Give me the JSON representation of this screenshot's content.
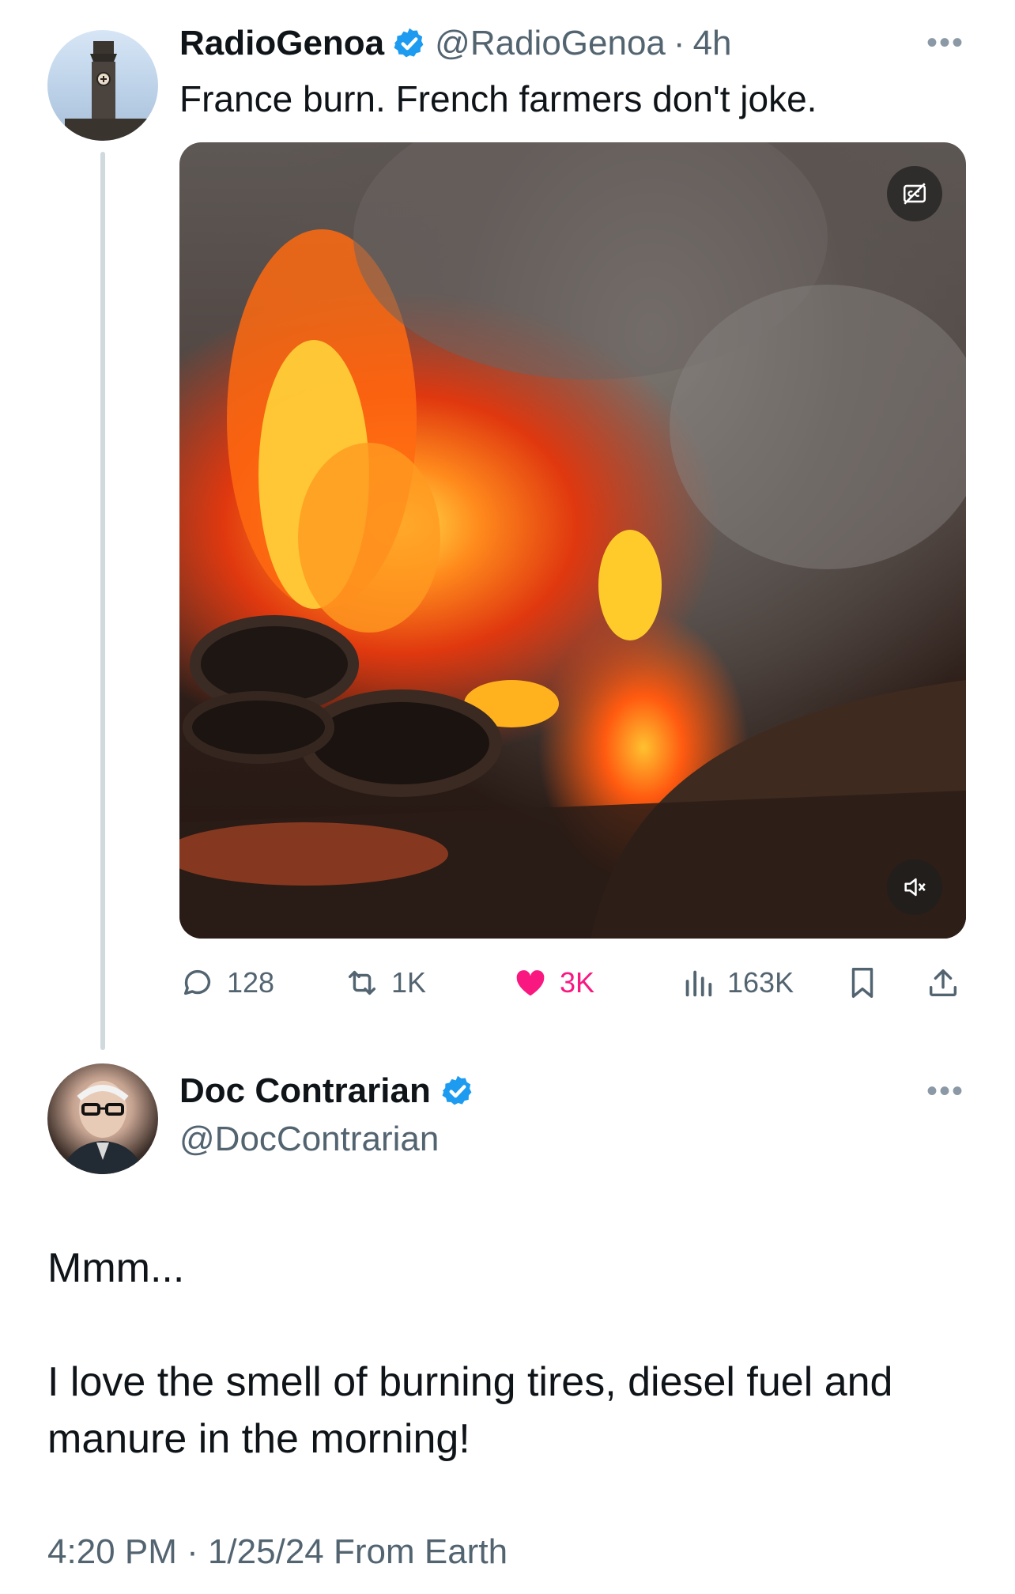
{
  "quoted_tweet": {
    "display_name": "RadioGenoa",
    "handle": "@RadioGenoa",
    "time": "4h",
    "text": "France burn. French farmers don't joke.",
    "media": {
      "captions_icon": "cc-off-icon",
      "mute_icon": "speaker-muted-icon"
    },
    "stats": {
      "replies": "128",
      "reposts": "1K",
      "likes": "3K",
      "views": "163K"
    }
  },
  "reply_tweet": {
    "display_name": "Doc Contrarian",
    "handle": "@DocContrarian",
    "body_line1": "Mmm...",
    "body_line2": "I love the smell of burning tires, diesel fuel and",
    "body_line3": "manure in the morning!",
    "timestamp": "4:20 PM · 1/25/24 From Earth"
  },
  "colors": {
    "verified_blue": "#1d9bf0",
    "like_pink": "#f91880",
    "muted_gray": "#536471",
    "thread_line": "#cfd9de"
  }
}
